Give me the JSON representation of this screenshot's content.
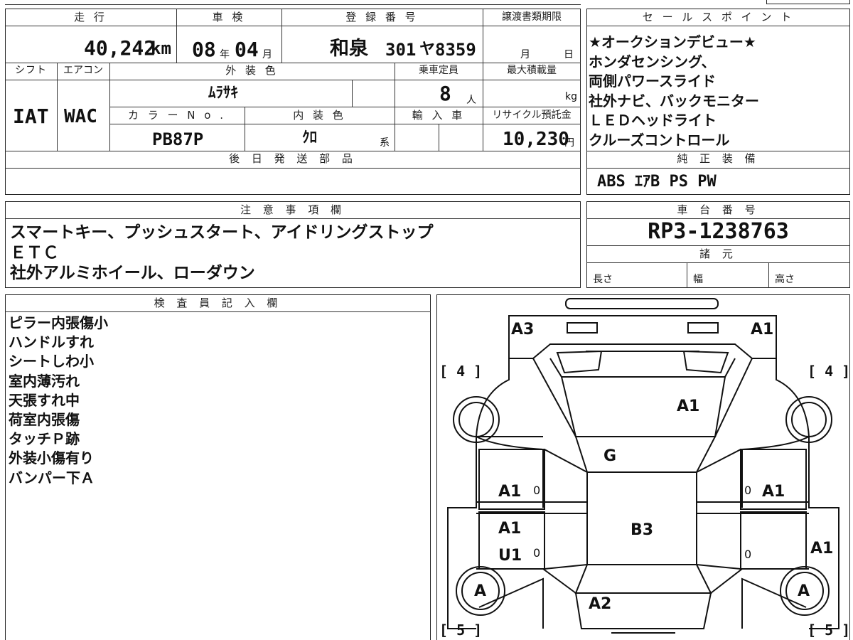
{
  "headers": {
    "mileage": "走 行",
    "inspection": "車 検",
    "registration": "登 録 番 号",
    "transfer_deadline": "譲渡書類期限",
    "sales_points": "セ ー ル ス ポ イ ン ト",
    "shift": "シフト",
    "aircon": "エアコン",
    "exterior_color": "外 装 色",
    "capacity": "乗車定員",
    "max_load": "最大積載量",
    "color_no": "カ ラ ー N o .",
    "interior_color": "内 装 色",
    "imported": "輸 入 車",
    "recycle_fee": "リサイクル預託金",
    "later_parts": "後 日 発 送 部 品",
    "genuine_equipment": "純 正 装 備",
    "notes": "注 意 事 項 欄",
    "chassis_number": "車 台 番 号",
    "specs": "諸 元",
    "inspector": "検 査 員 記 入 欄"
  },
  "values": {
    "mileage": "40,242",
    "mileage_unit": "km",
    "inspection_year": "08",
    "year_unit": "年",
    "inspection_month": "04",
    "month_unit": "月",
    "plate_area": "和泉",
    "plate_class": "301",
    "plate_kana": "ヤ",
    "plate_number": "8359",
    "deadline_month_unit": "月",
    "deadline_day_unit": "日",
    "shift": "IAT",
    "aircon": "WAC",
    "exterior_color": "ﾑﾗｻｷ",
    "capacity": "8",
    "capacity_unit": "人",
    "load_unit": "kg",
    "color_no": "PB87P",
    "interior_color": "ｸﾛ",
    "interior_suffix": "系",
    "recycle_fee": "10,230",
    "recycle_unit": "円",
    "chassis_number": "RP3-1238763",
    "genuine_equipment": "ABS ｴｱB PS PW",
    "spec_length": "長さ",
    "spec_width": "幅",
    "spec_height": "高さ"
  },
  "sales_points": [
    "★オークションデビュー★",
    "ホンダセンシング、",
    "両側パワースライド",
    "社外ナビ、バックモニター",
    "ＬＥＤヘッドライト",
    "クルーズコントロール"
  ],
  "notes": [
    "スマートキー、プッシュスタート、アイドリングストップ",
    "ＥＴＣ",
    "社外アルミホイール、ローダウン"
  ],
  "inspector_notes": [
    "ピラー内張傷小",
    "ハンドルすれ",
    "シートしわ小",
    "室内薄汚れ",
    "天張すれ中",
    "荷室内張傷",
    "タッチＰ跡",
    "外装小傷有り",
    "バンパー下Ａ"
  ],
  "diagram_marks": {
    "front_left": "A3",
    "front_right": "A1",
    "bracket_left_top": "[ 4 ]",
    "bracket_right_top": "[ 4 ]",
    "bracket_left_bottom": "[ 5 ]",
    "bracket_right_bottom": "[ 5 ]",
    "hood": "A1",
    "windshield": "G",
    "left_front_door": "A1",
    "right_front_door": "A1",
    "left_rear_door_1": "A1",
    "left_rear_door_2": "U1",
    "roof": "B3",
    "right_rear": "A1",
    "left_rear_wheel": "A",
    "right_rear_wheel": "A",
    "rear_glass": "A2",
    "small_zero": "0"
  }
}
